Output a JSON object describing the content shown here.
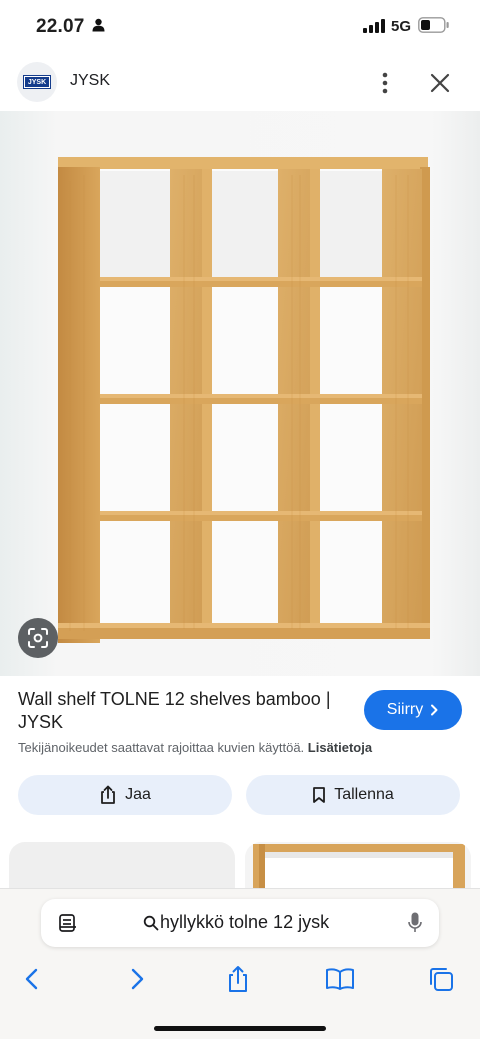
{
  "status_bar": {
    "time": "22.07",
    "network": "5G"
  },
  "header": {
    "logo_text": "JYSK",
    "site_name": "JYSK"
  },
  "product": {
    "title": "Wall shelf TOLNE 12 shelves bamboo | JYSK",
    "visit_label": "Siirry",
    "copyright_text": "Tekijänoikeudet saattavat rajoittaa kuvien käyttöä.",
    "more_info_label": "Lisätietoja"
  },
  "actions": {
    "share_label": "Jaa",
    "save_label": "Tallenna"
  },
  "browser": {
    "address_text": "hyllykkö tolne 12 jysk"
  },
  "colors": {
    "accent_blue": "#1a73e8",
    "button_bg": "#e8effa",
    "wood": "#d6a45a",
    "logo_blue": "#143c8c"
  },
  "icons": {
    "header": [
      "more-vert-icon",
      "close-icon"
    ],
    "image": [
      "lens-icon"
    ],
    "actions": [
      "share-icon",
      "bookmark-icon"
    ],
    "browser": [
      "reader-icon",
      "search-icon",
      "mic-icon",
      "back-icon",
      "forward-icon",
      "share-icon",
      "bookmarks-icon",
      "tabs-icon"
    ]
  }
}
